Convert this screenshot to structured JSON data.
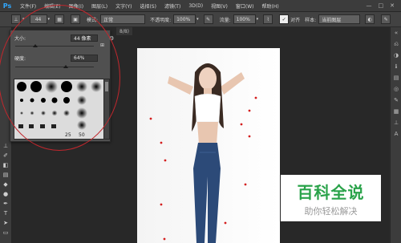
{
  "app": {
    "logo": "Ps"
  },
  "menu": [
    "文件(F)",
    "编辑(E)",
    "图像(I)",
    "图层(L)",
    "文字(Y)",
    "选择(S)",
    "滤镜(T)",
    "3D(D)",
    "视图(V)",
    "窗口(W)",
    "帮助(H)"
  ],
  "window_controls": [
    "—",
    "□",
    "✕"
  ],
  "options_bar": {
    "brush_size_badge": "44",
    "mode_label": "模式:",
    "mode_value": "正常",
    "opacity_label": "不透明度:",
    "opacity_value": "100%",
    "flow_label": "流量:",
    "flow_value": "100%",
    "align_label": "对齐",
    "sample_label": "样本:",
    "sample_value": "当前图层"
  },
  "document_tab": "8/8)",
  "brush_popup": {
    "size_label": "大小:",
    "size_value": "44 像素",
    "hardness_label": "硬度:",
    "hardness_value": "64%",
    "size_fraction": 0.25,
    "hardness_fraction": 0.64,
    "preset_labels": [
      "25",
      "50"
    ]
  },
  "watermark": {
    "title": "百科全说",
    "subtitle": "助你轻松解决"
  },
  "colors": {
    "annotation": "#c1272d",
    "watermark_green": "#2aa34a",
    "ps_blue": "#31a8ff"
  }
}
